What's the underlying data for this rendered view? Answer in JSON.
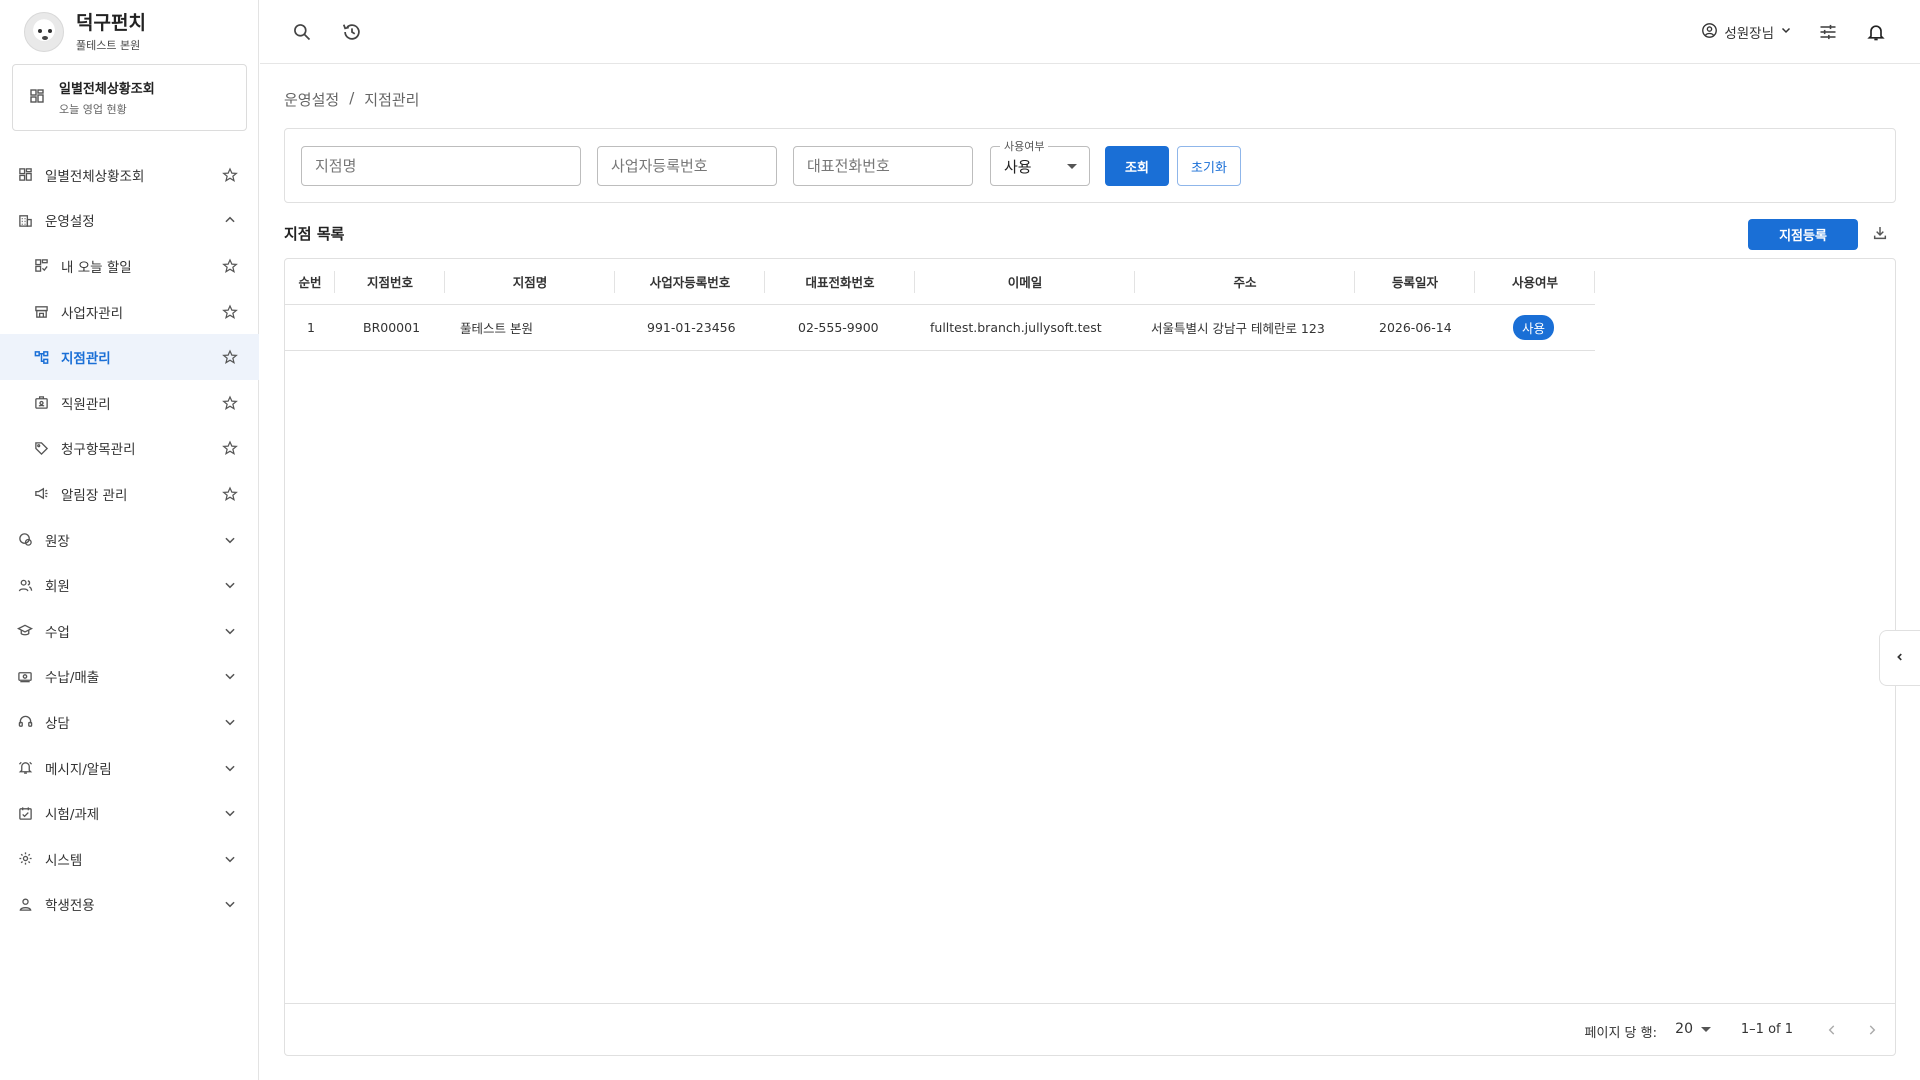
{
  "brand": {
    "name": "덕구펀치",
    "branch": "풀테스트 본원"
  },
  "quick_card": {
    "title": "일별전체상황조회",
    "subtitle": "오늘 영업 현황"
  },
  "sidebar": {
    "items": [
      {
        "label": "일별전체상황조회",
        "icon": "dashboard-icon",
        "right": "star"
      },
      {
        "label": "운영설정",
        "icon": "building-icon",
        "right": "chevron-up"
      },
      {
        "label": "내 오늘 할일",
        "icon": "checklist-icon",
        "right": "star"
      },
      {
        "label": "사업자관리",
        "icon": "store-icon",
        "right": "star"
      },
      {
        "label": "지점관리",
        "icon": "branch-icon",
        "right": "star"
      },
      {
        "label": "직원관리",
        "icon": "badge-icon",
        "right": "star"
      },
      {
        "label": "청구항목관리",
        "icon": "tag-icon",
        "right": "star"
      },
      {
        "label": "알림장 관리",
        "icon": "megaphone-icon",
        "right": "star"
      },
      {
        "label": "원장",
        "icon": "ledger-icon",
        "right": "chevron-down"
      },
      {
        "label": "회원",
        "icon": "members-icon",
        "right": "chevron-down"
      },
      {
        "label": "수업",
        "icon": "graduation-icon",
        "right": "chevron-down"
      },
      {
        "label": "수납/매출",
        "icon": "payment-icon",
        "right": "chevron-down"
      },
      {
        "label": "상담",
        "icon": "headset-icon",
        "right": "chevron-down"
      },
      {
        "label": "메시지/알림",
        "icon": "alarm-icon",
        "right": "chevron-down"
      },
      {
        "label": "시험/과제",
        "icon": "task-icon",
        "right": "chevron-down"
      },
      {
        "label": "시스템",
        "icon": "gear-icon",
        "right": "chevron-down"
      },
      {
        "label": "학생전용",
        "icon": "person-icon",
        "right": "chevron-down"
      }
    ]
  },
  "topbar": {
    "user_name": "성원장님"
  },
  "breadcrumb": {
    "parent": "운영설정",
    "separator": "/",
    "current": "지점관리"
  },
  "filters": {
    "branch_name_placeholder": "지점명",
    "biz_no_placeholder": "사업자등록번호",
    "phone_placeholder": "대표전화번호",
    "usage_label": "사용여부",
    "usage_value": "사용",
    "search_label": "조회",
    "reset_label": "초기화"
  },
  "list": {
    "title": "지점 목록",
    "register_label": "지점등록",
    "columns": [
      "순번",
      "지점번호",
      "지점명",
      "사업자등록번호",
      "대표전화번호",
      "이메일",
      "주소",
      "등록일자",
      "사용여부"
    ],
    "rows": [
      {
        "no": "1",
        "branch_no": "BR00001",
        "name": "풀테스트 본원",
        "biz_no": "991-01-23456",
        "phone": "02-555-9900",
        "email": "fulltest.branch.jullysoft.test",
        "address": "서울특별시 강남구 테헤란로 123",
        "date": "2026-06-14",
        "status": "사용"
      }
    ]
  },
  "pagination": {
    "rows_per_page_label": "페이지 당 행:",
    "rows_per_page": "20",
    "range": "1–1 of 1"
  },
  "colors": {
    "primary": "#1a6fd6",
    "active_bg": "#eef3fb",
    "border": "#e0e0e0"
  }
}
